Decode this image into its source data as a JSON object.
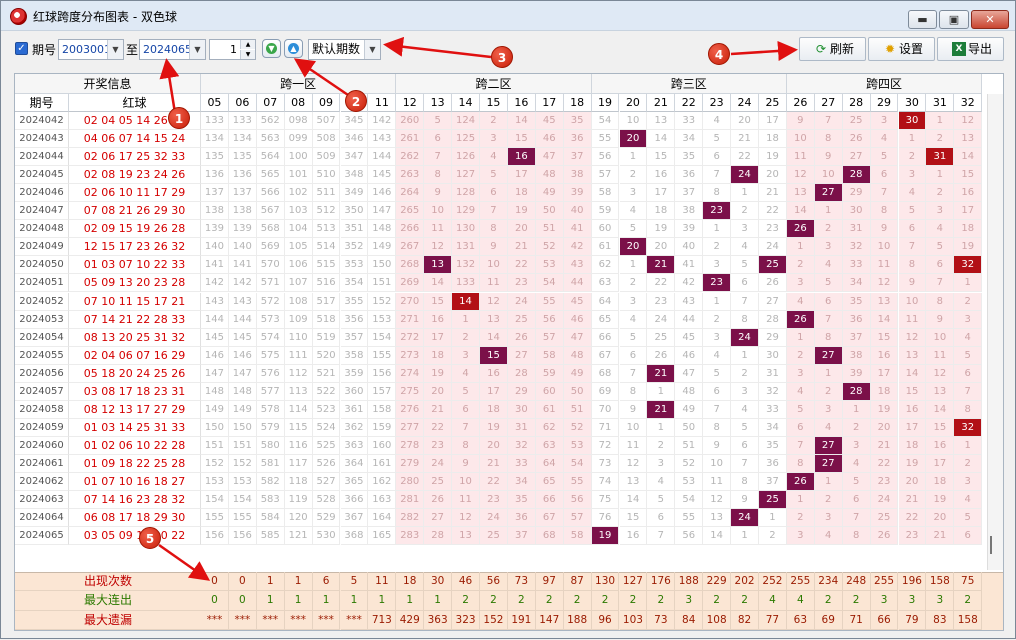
{
  "window": {
    "title": "红球跨度分布图表 - 双色球",
    "min_label": "▬",
    "max_label": "▣",
    "close_label": "✕"
  },
  "toolbar": {
    "check_label": "期号",
    "from_value": "2003001",
    "to_label": "至",
    "to_value": "2024065",
    "step_value": "1",
    "period_select": "默认期数",
    "refresh_label": "刷新",
    "settings_label": "设置",
    "export_label": "导出"
  },
  "annotations": [
    "1",
    "2",
    "3",
    "4",
    "5"
  ],
  "icons": {
    "check": "checkbox-checked-icon",
    "refresh": "refresh-icon",
    "settings": "gear-icon",
    "export": "excel-icon",
    "down": "arrow-down-circle-icon",
    "up": "arrow-up-circle-icon"
  },
  "colors": {
    "pink_bg": "#fde8ea",
    "gray_text": "#b5b5b5",
    "pink_text": "#cfa4a7",
    "hit_purple": "#7b1049",
    "hit_red": "#b21016",
    "stat_bg": "#fbe6d4",
    "stat_label": "#bf0000",
    "red_ball": "#d40000"
  },
  "header": {
    "group_info": "开奖信息",
    "zones": [
      "跨一区",
      "跨二区",
      "跨三区",
      "跨四区"
    ],
    "issue_col": "期号",
    "red_col": "红球",
    "spans": [
      "05",
      "06",
      "07",
      "08",
      "09",
      "10",
      "11",
      "12",
      "13",
      "14",
      "15",
      "16",
      "17",
      "18",
      "19",
      "20",
      "21",
      "22",
      "23",
      "24",
      "25",
      "26",
      "27",
      "28",
      "29",
      "30",
      "31",
      "32"
    ]
  },
  "rows": [
    {
      "issue": "2024042",
      "balls": "02 04 05 14 26 30",
      "cells": [
        "133",
        "133",
        "562",
        "098",
        "507",
        "345",
        "142",
        "260",
        "5",
        "124",
        "2",
        "14",
        "45",
        "35",
        "54",
        "10",
        "13",
        "33",
        "4",
        "20",
        "17",
        "9",
        "7",
        "25",
        "3",
        "30",
        "1",
        "12"
      ]
    },
    {
      "issue": "2024043",
      "balls": "04 06 07 14 15 24",
      "cells": [
        "134",
        "134",
        "563",
        "099",
        "508",
        "346",
        "143",
        "261",
        "6",
        "125",
        "3",
        "15",
        "46",
        "36",
        "55",
        "20",
        "14",
        "34",
        "5",
        "21",
        "18",
        "10",
        "8",
        "26",
        "4",
        "1",
        "2",
        "13"
      ]
    },
    {
      "issue": "2024044",
      "balls": "02 06 17 25 32 33",
      "cells": [
        "135",
        "135",
        "564",
        "100",
        "509",
        "347",
        "144",
        "262",
        "7",
        "126",
        "4",
        "16",
        "47",
        "37",
        "56",
        "1",
        "15",
        "35",
        "6",
        "22",
        "19",
        "11",
        "9",
        "27",
        "5",
        "2",
        "31",
        "14"
      ]
    },
    {
      "issue": "2024045",
      "balls": "02 08 19 23 24 26",
      "cells": [
        "136",
        "136",
        "565",
        "101",
        "510",
        "348",
        "145",
        "263",
        "8",
        "127",
        "5",
        "17",
        "48",
        "38",
        "57",
        "2",
        "16",
        "36",
        "7",
        "24",
        "20",
        "12",
        "10",
        "28",
        "6",
        "3",
        "1",
        "15"
      ]
    },
    {
      "issue": "2024046",
      "balls": "02 06 10 11 17 29",
      "cells": [
        "137",
        "137",
        "566",
        "102",
        "511",
        "349",
        "146",
        "264",
        "9",
        "128",
        "6",
        "18",
        "49",
        "39",
        "58",
        "3",
        "17",
        "37",
        "8",
        "1",
        "21",
        "13",
        "27",
        "29",
        "7",
        "4",
        "2",
        "16"
      ]
    },
    {
      "issue": "2024047",
      "balls": "07 08 21 26 29 30",
      "cells": [
        "138",
        "138",
        "567",
        "103",
        "512",
        "350",
        "147",
        "265",
        "10",
        "129",
        "7",
        "19",
        "50",
        "40",
        "59",
        "4",
        "18",
        "38",
        "23",
        "2",
        "22",
        "14",
        "1",
        "30",
        "8",
        "5",
        "3",
        "17"
      ]
    },
    {
      "issue": "2024048",
      "balls": "02 09 15 19 26 28",
      "cells": [
        "139",
        "139",
        "568",
        "104",
        "513",
        "351",
        "148",
        "266",
        "11",
        "130",
        "8",
        "20",
        "51",
        "41",
        "60",
        "5",
        "19",
        "39",
        "1",
        "3",
        "23",
        "26",
        "2",
        "31",
        "9",
        "6",
        "4",
        "18"
      ]
    },
    {
      "issue": "2024049",
      "balls": "12 15 17 23 26 32",
      "cells": [
        "140",
        "140",
        "569",
        "105",
        "514",
        "352",
        "149",
        "267",
        "12",
        "131",
        "9",
        "21",
        "52",
        "42",
        "61",
        "20",
        "20",
        "40",
        "2",
        "4",
        "24",
        "1",
        "3",
        "32",
        "10",
        "7",
        "5",
        "19"
      ]
    },
    {
      "issue": "2024050",
      "balls": "01 03 07 10 22 33",
      "cells": [
        "141",
        "141",
        "570",
        "106",
        "515",
        "353",
        "150",
        "268",
        "13",
        "132",
        "10",
        "22",
        "53",
        "43",
        "62",
        "1",
        "21",
        "41",
        "3",
        "5",
        "25",
        "2",
        "4",
        "33",
        "11",
        "8",
        "6",
        "32"
      ]
    },
    {
      "issue": "2024051",
      "balls": "05 09 13 20 23 28",
      "cells": [
        "142",
        "142",
        "571",
        "107",
        "516",
        "354",
        "151",
        "269",
        "14",
        "133",
        "11",
        "23",
        "54",
        "44",
        "63",
        "2",
        "22",
        "42",
        "23",
        "6",
        "26",
        "3",
        "5",
        "34",
        "12",
        "9",
        "7",
        "1"
      ]
    },
    {
      "issue": "2024052",
      "balls": "07 10 11 15 17 21",
      "cells": [
        "143",
        "143",
        "572",
        "108",
        "517",
        "355",
        "152",
        "270",
        "15",
        "14",
        "12",
        "24",
        "55",
        "45",
        "64",
        "3",
        "23",
        "43",
        "1",
        "7",
        "27",
        "4",
        "6",
        "35",
        "13",
        "10",
        "8",
        "2"
      ]
    },
    {
      "issue": "2024053",
      "balls": "07 14 21 22 28 33",
      "cells": [
        "144",
        "144",
        "573",
        "109",
        "518",
        "356",
        "153",
        "271",
        "16",
        "1",
        "13",
        "25",
        "56",
        "46",
        "65",
        "4",
        "24",
        "44",
        "2",
        "8",
        "28",
        "26",
        "7",
        "36",
        "14",
        "11",
        "9",
        "3"
      ]
    },
    {
      "issue": "2024054",
      "balls": "08 13 20 25 31 32",
      "cells": [
        "145",
        "145",
        "574",
        "110",
        "519",
        "357",
        "154",
        "272",
        "17",
        "2",
        "14",
        "26",
        "57",
        "47",
        "66",
        "5",
        "25",
        "45",
        "3",
        "24",
        "29",
        "1",
        "8",
        "37",
        "15",
        "12",
        "10",
        "4"
      ]
    },
    {
      "issue": "2024055",
      "balls": "02 04 06 07 16 29",
      "cells": [
        "146",
        "146",
        "575",
        "111",
        "520",
        "358",
        "155",
        "273",
        "18",
        "3",
        "15",
        "27",
        "58",
        "48",
        "67",
        "6",
        "26",
        "46",
        "4",
        "1",
        "30",
        "2",
        "27",
        "38",
        "16",
        "13",
        "11",
        "5"
      ]
    },
    {
      "issue": "2024056",
      "balls": "05 18 20 24 25 26",
      "cells": [
        "147",
        "147",
        "576",
        "112",
        "521",
        "359",
        "156",
        "274",
        "19",
        "4",
        "16",
        "28",
        "59",
        "49",
        "68",
        "7",
        "21",
        "47",
        "5",
        "2",
        "31",
        "3",
        "1",
        "39",
        "17",
        "14",
        "12",
        "6"
      ]
    },
    {
      "issue": "2024057",
      "balls": "03 08 17 18 23 31",
      "cells": [
        "148",
        "148",
        "577",
        "113",
        "522",
        "360",
        "157",
        "275",
        "20",
        "5",
        "17",
        "29",
        "60",
        "50",
        "69",
        "8",
        "1",
        "48",
        "6",
        "3",
        "32",
        "4",
        "2",
        "28",
        "18",
        "15",
        "13",
        "7"
      ]
    },
    {
      "issue": "2024058",
      "balls": "08 12 13 17 27 29",
      "cells": [
        "149",
        "149",
        "578",
        "114",
        "523",
        "361",
        "158",
        "276",
        "21",
        "6",
        "18",
        "30",
        "61",
        "51",
        "70",
        "9",
        "21",
        "49",
        "7",
        "4",
        "33",
        "5",
        "3",
        "1",
        "19",
        "16",
        "14",
        "8"
      ]
    },
    {
      "issue": "2024059",
      "balls": "01 03 14 25 31 33",
      "cells": [
        "150",
        "150",
        "579",
        "115",
        "524",
        "362",
        "159",
        "277",
        "22",
        "7",
        "19",
        "31",
        "62",
        "52",
        "71",
        "10",
        "1",
        "50",
        "8",
        "5",
        "34",
        "6",
        "4",
        "2",
        "20",
        "17",
        "15",
        "32"
      ]
    },
    {
      "issue": "2024060",
      "balls": "01 02 06 10 22 28",
      "cells": [
        "151",
        "151",
        "580",
        "116",
        "525",
        "363",
        "160",
        "278",
        "23",
        "8",
        "20",
        "32",
        "63",
        "53",
        "72",
        "11",
        "2",
        "51",
        "9",
        "6",
        "35",
        "7",
        "27",
        "3",
        "21",
        "18",
        "16",
        "1"
      ]
    },
    {
      "issue": "2024061",
      "balls": "01 09 18 22 25 28",
      "cells": [
        "152",
        "152",
        "581",
        "117",
        "526",
        "364",
        "161",
        "279",
        "24",
        "9",
        "21",
        "33",
        "64",
        "54",
        "73",
        "12",
        "3",
        "52",
        "10",
        "7",
        "36",
        "8",
        "27",
        "4",
        "22",
        "19",
        "17",
        "2"
      ]
    },
    {
      "issue": "2024062",
      "balls": "01 07 10 16 18 27",
      "cells": [
        "153",
        "153",
        "582",
        "118",
        "527",
        "365",
        "162",
        "280",
        "25",
        "10",
        "22",
        "34",
        "65",
        "55",
        "74",
        "13",
        "4",
        "53",
        "11",
        "8",
        "37",
        "26",
        "1",
        "5",
        "23",
        "20",
        "18",
        "3"
      ]
    },
    {
      "issue": "2024063",
      "balls": "07 14 16 23 28 32",
      "cells": [
        "154",
        "154",
        "583",
        "119",
        "528",
        "366",
        "163",
        "281",
        "26",
        "11",
        "23",
        "35",
        "66",
        "56",
        "75",
        "14",
        "5",
        "54",
        "12",
        "9",
        "25",
        "1",
        "2",
        "6",
        "24",
        "21",
        "19",
        "4"
      ]
    },
    {
      "issue": "2024064",
      "balls": "06 08 17 18 29 30",
      "cells": [
        "155",
        "155",
        "584",
        "120",
        "529",
        "367",
        "164",
        "282",
        "27",
        "12",
        "24",
        "36",
        "67",
        "57",
        "76",
        "15",
        "6",
        "55",
        "13",
        "24",
        "1",
        "2",
        "3",
        "7",
        "25",
        "22",
        "20",
        "5"
      ]
    },
    {
      "issue": "2024065",
      "balls": "03 05 09 18 20 22",
      "cells": [
        "156",
        "156",
        "585",
        "121",
        "530",
        "368",
        "165",
        "283",
        "28",
        "13",
        "25",
        "37",
        "68",
        "58",
        "19",
        "16",
        "7",
        "56",
        "14",
        "1",
        "2",
        "3",
        "4",
        "8",
        "26",
        "23",
        "21",
        "6"
      ]
    }
  ],
  "stats": [
    {
      "label": "出现次数",
      "values": [
        "0",
        "0",
        "1",
        "1",
        "6",
        "5",
        "11",
        "18",
        "30",
        "46",
        "56",
        "73",
        "97",
        "87",
        "130",
        "127",
        "176",
        "188",
        "229",
        "202",
        "252",
        "255",
        "234",
        "248",
        "255",
        "196",
        "158",
        "75"
      ]
    },
    {
      "label": "最大连出",
      "values": [
        "0",
        "0",
        "1",
        "1",
        "1",
        "1",
        "1",
        "1",
        "1",
        "2",
        "2",
        "2",
        "2",
        "2",
        "2",
        "2",
        "2",
        "3",
        "2",
        "2",
        "4",
        "4",
        "2",
        "2",
        "3",
        "3",
        "3",
        "2"
      ]
    },
    {
      "label": "最大遗漏",
      "values": [
        "***",
        "***",
        "***",
        "***",
        "***",
        "***",
        "713",
        "429",
        "363",
        "323",
        "152",
        "191",
        "147",
        "188",
        "96",
        "103",
        "73",
        "84",
        "108",
        "82",
        "77",
        "63",
        "69",
        "71",
        "66",
        "79",
        "83",
        "158"
      ]
    }
  ]
}
